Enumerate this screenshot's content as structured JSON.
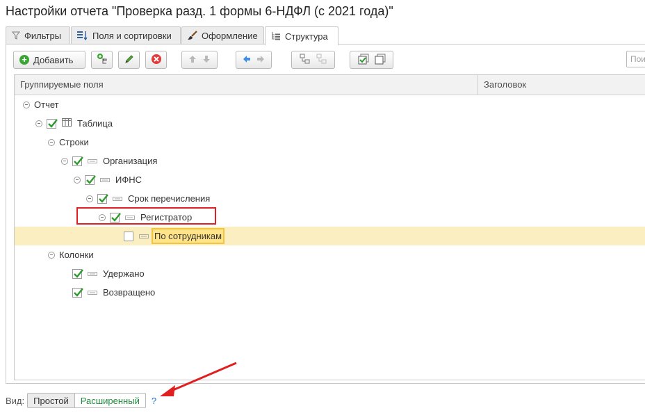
{
  "window": {
    "title": "Настройки отчета \"Проверка разд. 1 формы 6-НДФЛ (с 2021 года)\""
  },
  "tabs": [
    {
      "label": "Фильтры",
      "icon": "funnel-icon"
    },
    {
      "label": "Поля и сортировки",
      "icon": "fields-sort-icon"
    },
    {
      "label": "Оформление",
      "icon": "brush-icon"
    },
    {
      "label": "Структура",
      "icon": "structure-icon",
      "active": true
    }
  ],
  "toolbar": {
    "add_label": "Добавить",
    "search_placeholder": "Поиск"
  },
  "grid": {
    "columns": [
      "Группируемые поля",
      "Заголовок"
    ],
    "rows": [
      {
        "label": "Отчет",
        "level": 0,
        "toggle": true,
        "checkbox": false,
        "icon": "none"
      },
      {
        "label": "Таблица",
        "level": 1,
        "toggle": true,
        "checkbox": true,
        "checked": true,
        "icon": "table-icon"
      },
      {
        "label": "Строки",
        "level": 2,
        "toggle": true,
        "checkbox": false,
        "icon": "none"
      },
      {
        "label": "Организация",
        "level": 3,
        "toggle": true,
        "checkbox": true,
        "checked": true,
        "icon": "field-icon"
      },
      {
        "label": "ИФНС",
        "level": 4,
        "toggle": true,
        "checkbox": true,
        "checked": true,
        "icon": "field-icon"
      },
      {
        "label": "Срок перечисления",
        "level": 5,
        "toggle": true,
        "checkbox": true,
        "checked": true,
        "icon": "field-icon"
      },
      {
        "label": "Регистратор",
        "level": 6,
        "toggle": true,
        "checkbox": true,
        "checked": true,
        "icon": "field-icon",
        "outlined": true
      },
      {
        "label": "По сотрудникам",
        "level": 7,
        "toggle": false,
        "checkbox": true,
        "checked": false,
        "icon": "field-icon",
        "selected": true
      },
      {
        "label": "Колонки",
        "level": 2,
        "toggle": true,
        "checkbox": false,
        "icon": "none"
      },
      {
        "label": "Удержано",
        "level": 3,
        "toggle": false,
        "checkbox": true,
        "checked": true,
        "icon": "field-icon"
      },
      {
        "label": "Возвращено",
        "level": 3,
        "toggle": false,
        "checkbox": true,
        "checked": true,
        "icon": "field-icon"
      }
    ]
  },
  "view_mode": {
    "label": "Вид:",
    "options": [
      "Простой",
      "Расширенный"
    ],
    "selected": "Расширенный",
    "help": "?"
  },
  "colors": {
    "accent_green": "#3aa535",
    "selection": "#fbefc2",
    "highlight_border": "#f2c443",
    "annotation_red": "#e02020"
  }
}
